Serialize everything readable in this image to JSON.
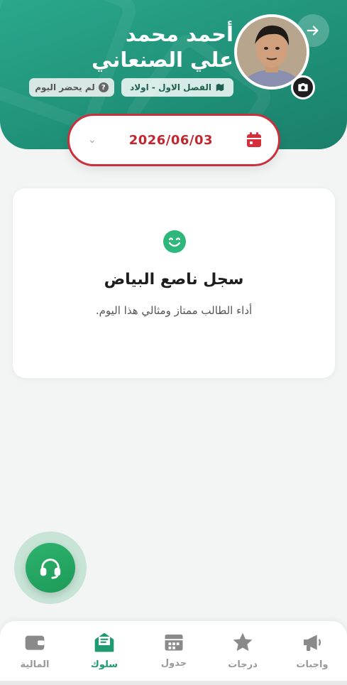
{
  "header": {
    "student_name": "أحمد محمد علي الصنعاني",
    "class_label": "الفصل الاول - اولاد",
    "attendance_label": "لم يحضر اليوم"
  },
  "date_selector": {
    "value": "2026/06/03"
  },
  "behavior_card": {
    "title": "سجل ناصع البياض",
    "subtitle": "أداء الطالب ممتاز ومثالي هذا اليوم."
  },
  "bottom_nav": {
    "items": [
      {
        "label": "واجبات",
        "icon": "megaphone-icon"
      },
      {
        "label": "درجات",
        "icon": "star-icon"
      },
      {
        "label": "جدول",
        "icon": "calendar-icon"
      },
      {
        "label": "سلوك",
        "icon": "envelope-icon",
        "active": true
      },
      {
        "label": "المالية",
        "icon": "wallet-icon"
      }
    ]
  },
  "colors": {
    "primary": "#1f8f77",
    "accent_red": "#c0272f",
    "active_nav": "#1e9a70"
  }
}
